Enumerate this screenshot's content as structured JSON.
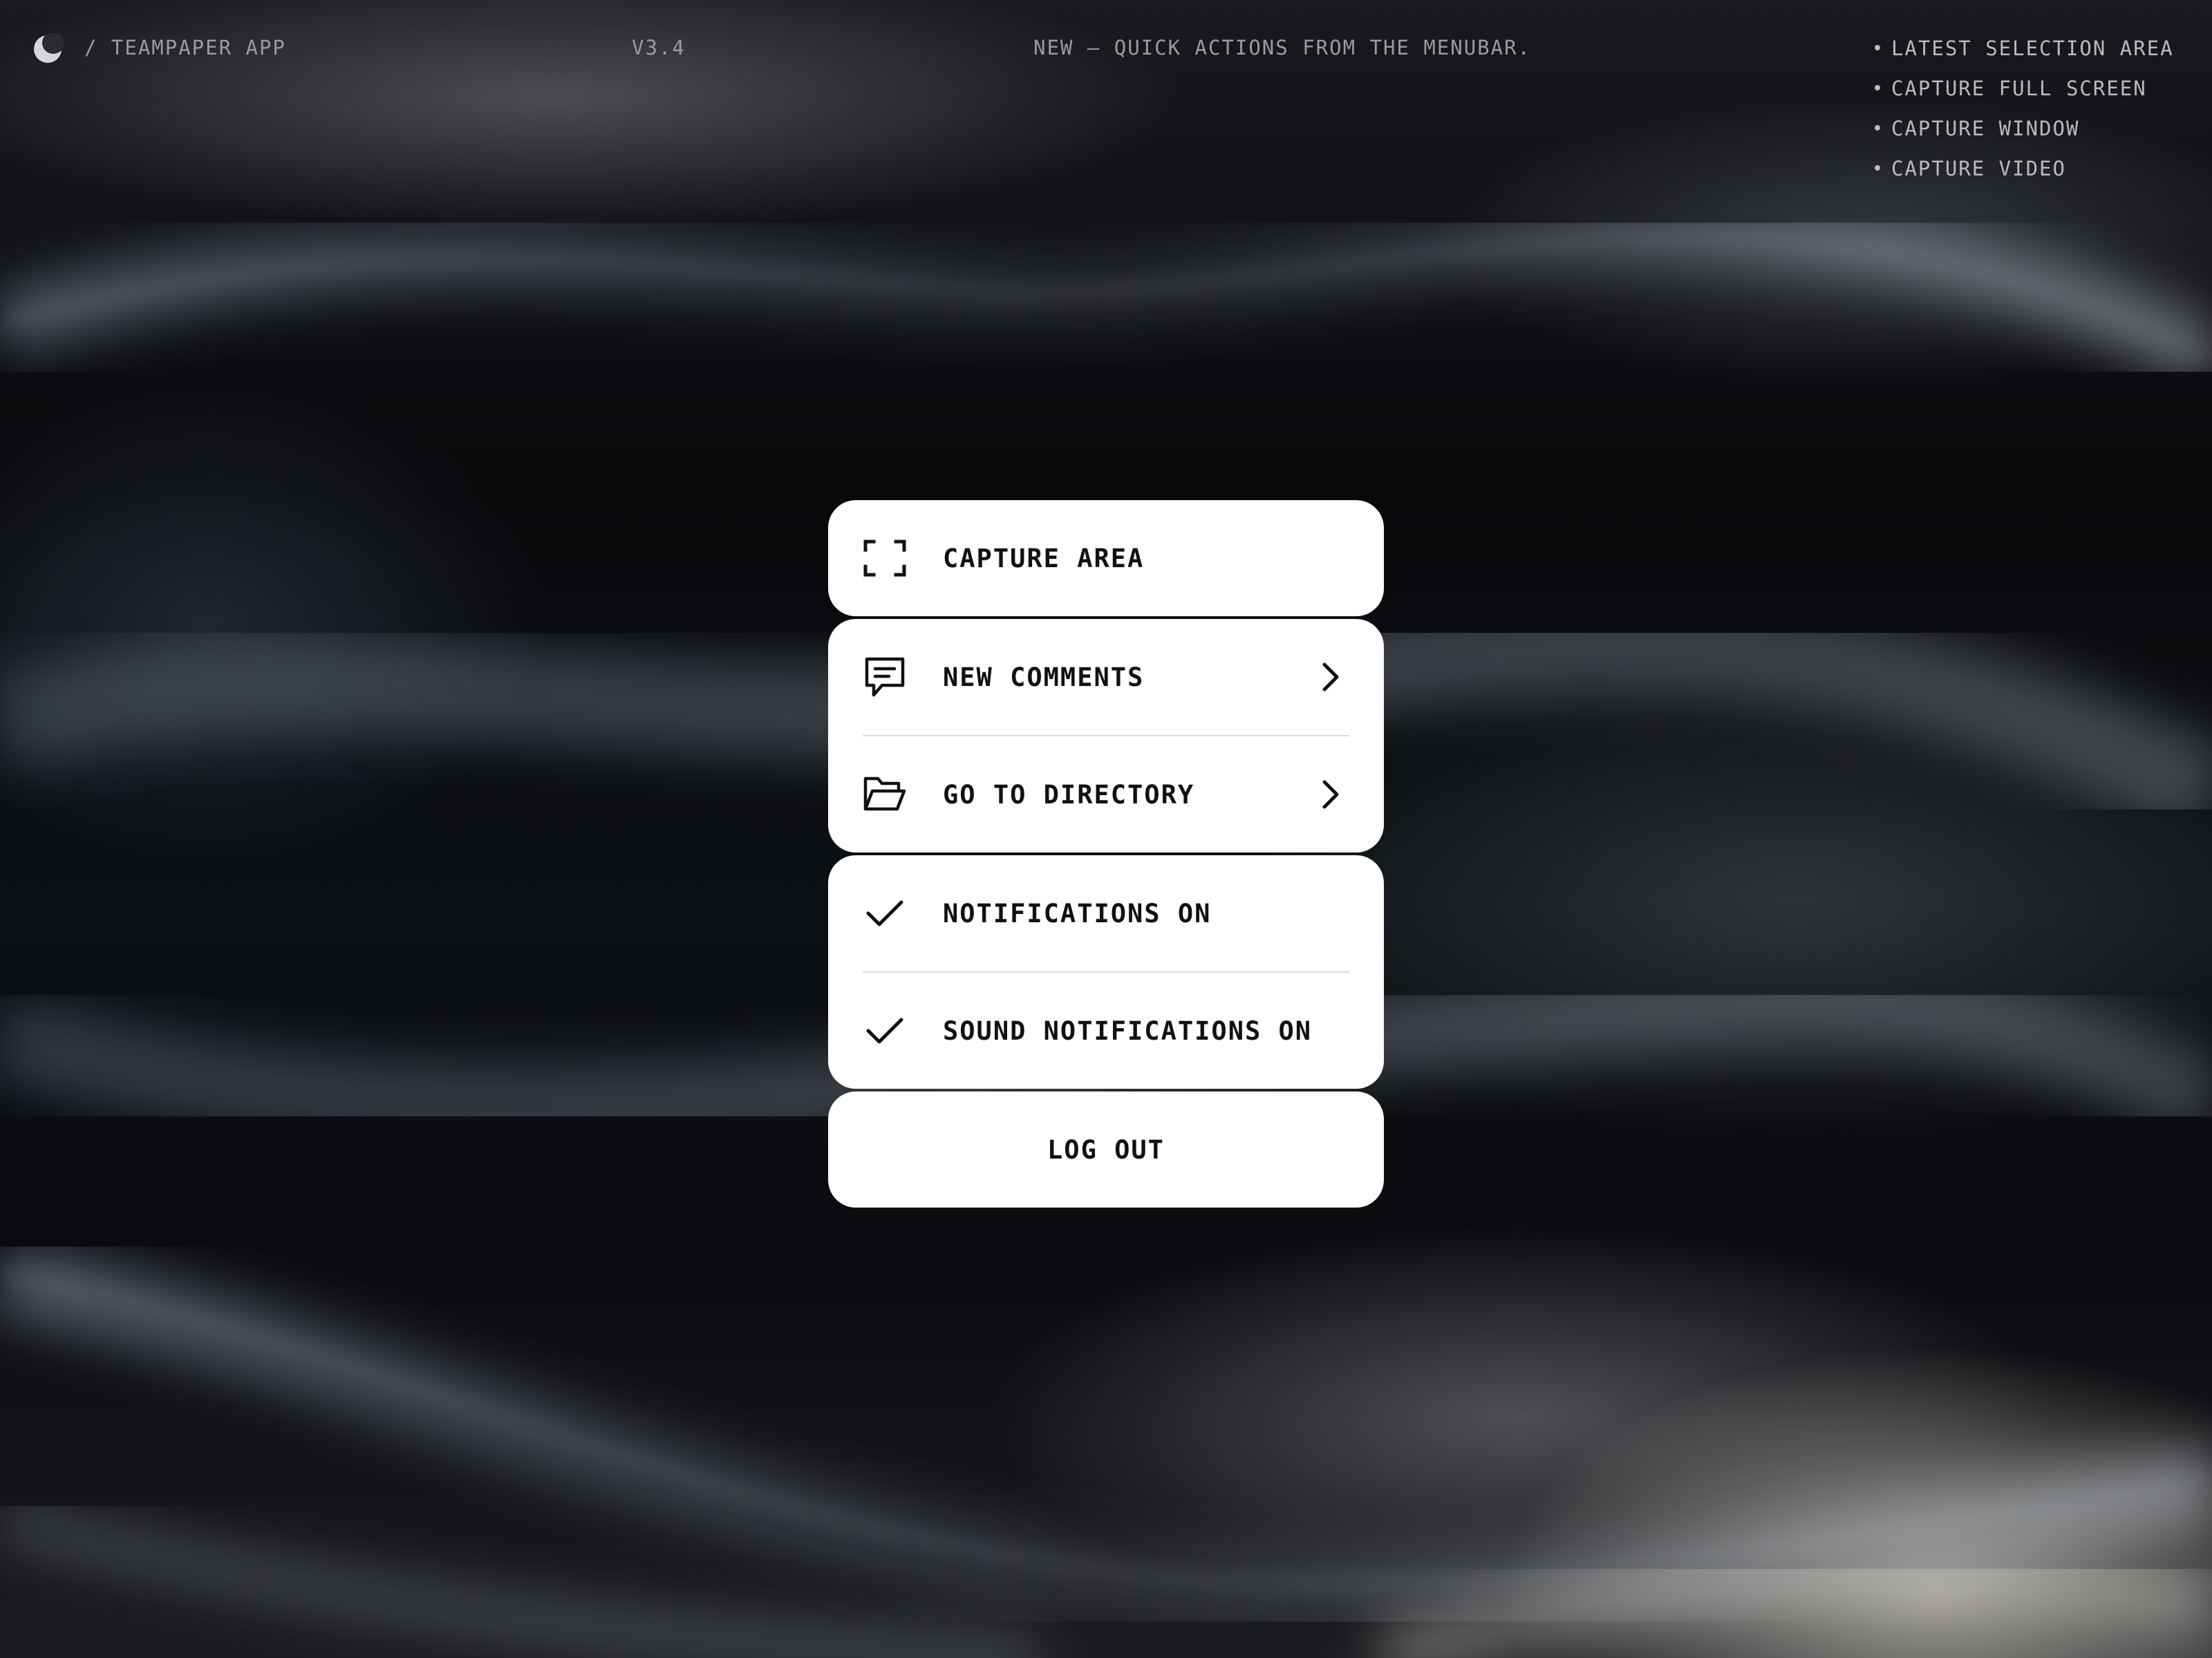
{
  "header": {
    "app_name": "/ TEAMPAPER APP",
    "version": "V3.4",
    "news": "NEW — QUICK ACTIONS FROM THE MENUBAR.",
    "logo_icon": "moon-icon"
  },
  "quick_actions": [
    {
      "label": "LATEST SELECTION AREA"
    },
    {
      "label": "CAPTURE FULL SCREEN"
    },
    {
      "label": "CAPTURE WINDOW"
    },
    {
      "label": "CAPTURE VIDEO"
    }
  ],
  "menu": {
    "capture_area": {
      "label": "CAPTURE AREA",
      "icon": "selection-frame-icon"
    },
    "new_comments": {
      "label": "NEW COMMENTS",
      "icon": "comment-icon"
    },
    "go_to_directory": {
      "label": "GO TO DIRECTORY",
      "icon": "folder-open-icon"
    },
    "notifications": {
      "label": "NOTIFICATIONS ON",
      "icon": "check-icon",
      "checked": true
    },
    "sound_notifications": {
      "label": "SOUND NOTIFICATIONS ON",
      "icon": "check-icon",
      "checked": true
    },
    "log_out": {
      "label": "LOG OUT"
    }
  },
  "colors": {
    "card_background": "#ffffff",
    "card_text": "#101114",
    "header_text": "#9a9b9e",
    "background": "#050608"
  }
}
